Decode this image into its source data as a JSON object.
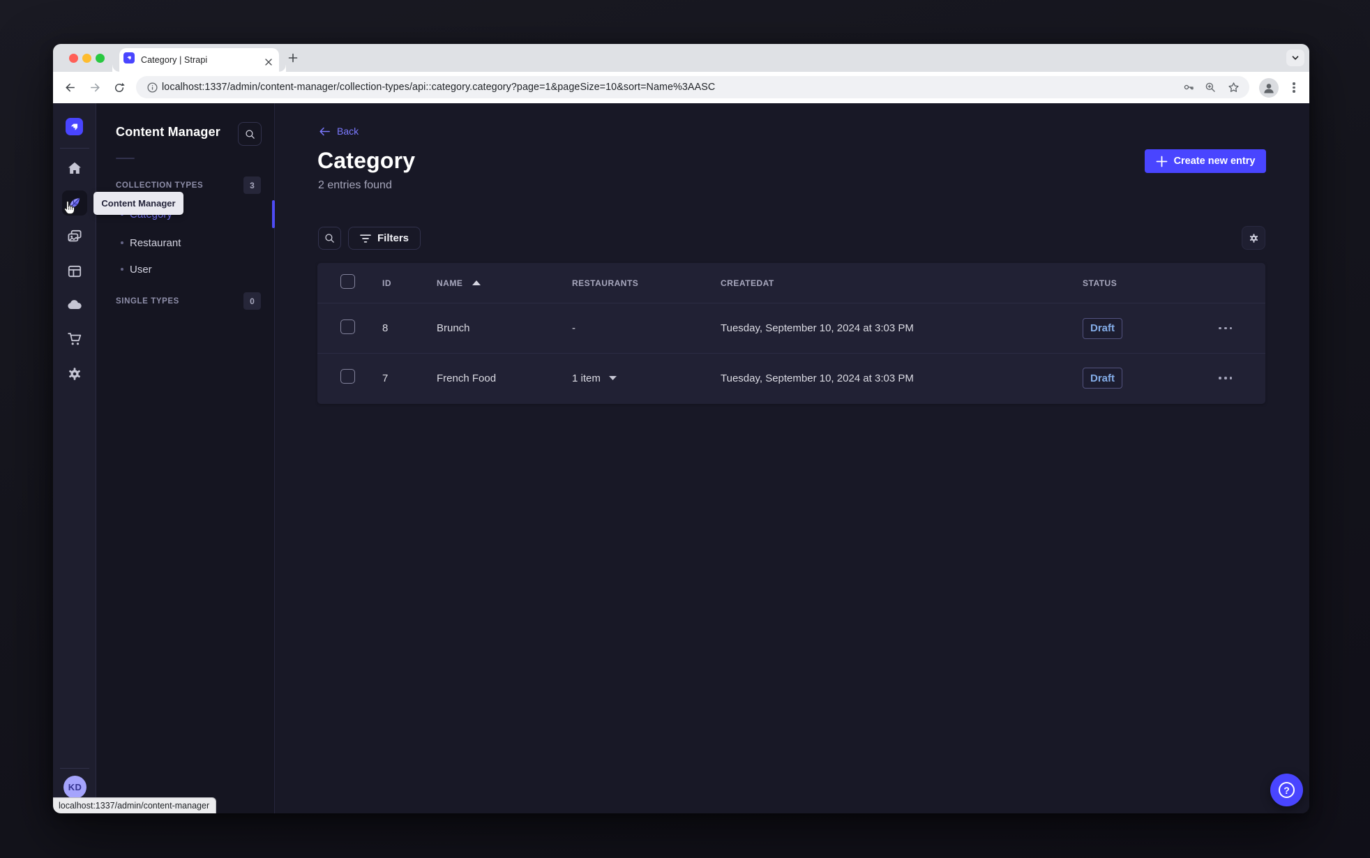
{
  "browser": {
    "tab_title": "Category | Strapi",
    "url": "localhost:1337/admin/content-manager/collection-types/api::category.category?page=1&pageSize=10&sort=Name%3AASC",
    "status_link": "localhost:1337/admin/content-manager"
  },
  "colors": {
    "accent": "#4945ff",
    "accent_light": "#7b79ff",
    "page_bg": "#181826",
    "card_bg": "#212134",
    "draft_text": "#84ade8"
  },
  "sidebar": {
    "tooltip": "Content Manager",
    "heading": "Content Manager",
    "avatar_initials": "KD",
    "sections": [
      {
        "label": "COLLECTION TYPES",
        "badge": "3"
      },
      {
        "label": "SINGLE TYPES",
        "badge": "0"
      }
    ],
    "items": [
      {
        "label": "Category"
      },
      {
        "label": "Restaurant"
      },
      {
        "label": "User"
      }
    ]
  },
  "icons": {
    "help_glyph": "?"
  },
  "content": {
    "back_label": "Back",
    "title": "Category",
    "subtitle": "2 entries found",
    "create_button": "Create new entry",
    "filters_button": "Filters"
  },
  "table": {
    "headers": {
      "id": "ID",
      "name": "NAME",
      "restaurants": "RESTAURANTS",
      "createdat": "CREATEDAT",
      "status": "STATUS"
    },
    "rows": [
      {
        "id": "8",
        "name": "Brunch",
        "restaurants": "-",
        "createdat": "Tuesday, September 10, 2024 at 3:03 PM",
        "status": "Draft"
      },
      {
        "id": "7",
        "name": "French Food",
        "restaurants": "1 item",
        "createdat": "Tuesday, September 10, 2024 at 3:03 PM",
        "status": "Draft"
      }
    ]
  }
}
